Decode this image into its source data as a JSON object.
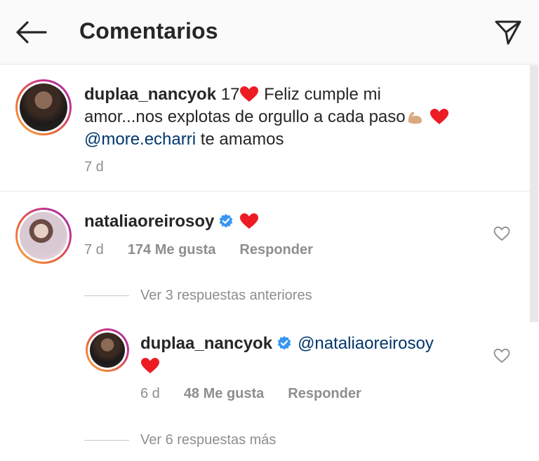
{
  "header": {
    "title": "Comentarios",
    "back_icon": "back-arrow-icon",
    "send_icon": "paper-plane-icon"
  },
  "caption": {
    "username": "duplaa_nancyok",
    "text_1": " 17",
    "text_2": " Feliz cumple mi",
    "text_3": "amor...nos explotas de orgullo a cada paso",
    "mention": "@more.echarri",
    "text_4": " te amamos",
    "time": "7 d"
  },
  "comment": {
    "username": "nataliaoreirosoy",
    "time": "7 d",
    "likes": "174 Me gusta",
    "reply": "Responder",
    "view_prev_replies": "Ver 3 respuestas anteriores"
  },
  "reply": {
    "username": "duplaa_nancyok",
    "mention": "@nataliaoreirosoy",
    "time": "6 d",
    "likes": "48 Me gusta",
    "reply": "Responder",
    "view_more_replies": "Ver 6 respuestas más"
  },
  "colors": {
    "heart": "#ed1c24",
    "verified": "#3897f0",
    "mention": "#00376b",
    "meta": "#8e8e8e"
  }
}
